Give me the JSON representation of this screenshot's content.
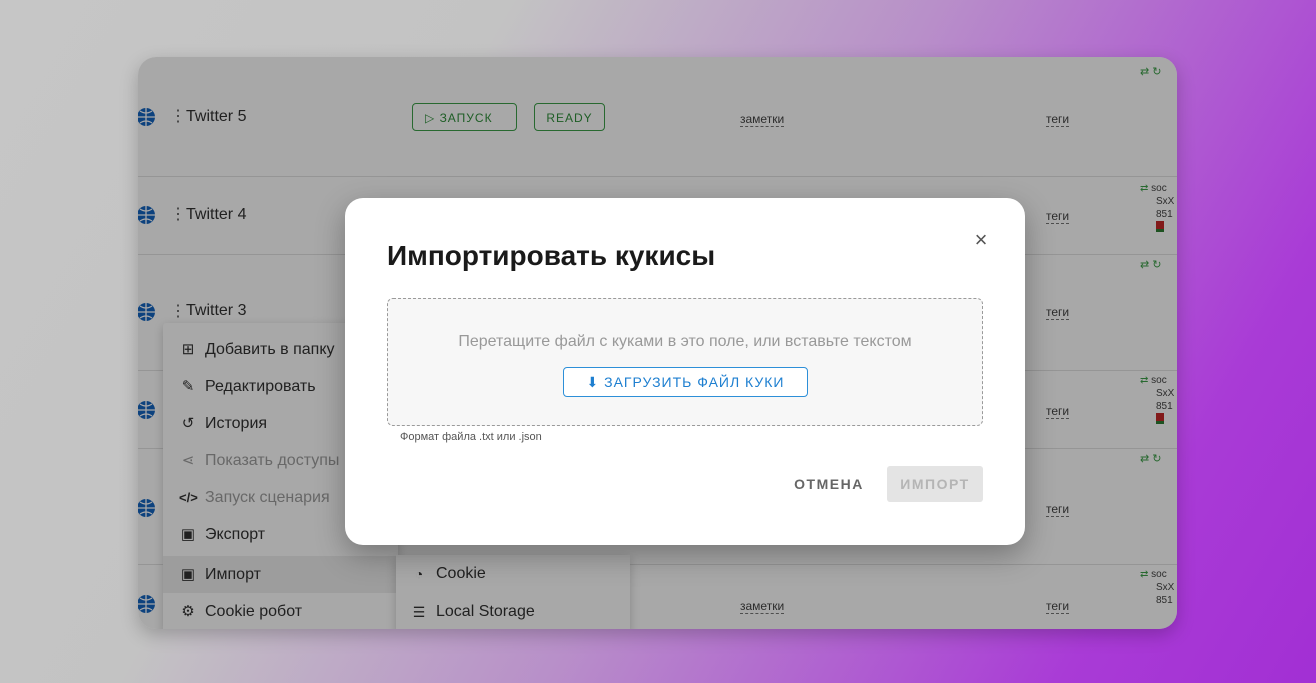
{
  "profiles": [
    {
      "name": "Twitter 5",
      "launch": "ЗАПУСК",
      "status": "READY",
      "notes": "заметки",
      "tags": "теги",
      "info": []
    },
    {
      "name": "Twitter 4",
      "tags": "теги",
      "info": [
        "soc",
        "SxX",
        "851"
      ]
    },
    {
      "name": "Twitter 3",
      "tags": "теги",
      "info": []
    },
    {
      "name": "",
      "tags": "теги",
      "info": [
        "soc",
        "SxX",
        "851"
      ]
    },
    {
      "name": "",
      "tags": "теги",
      "info": []
    },
    {
      "name": "",
      "notes": "заметки",
      "tags": "теги",
      "info": [
        "soc",
        "SxX",
        "851"
      ]
    }
  ],
  "context_menu": [
    {
      "label": "Добавить в папку",
      "icon": "folder-plus-icon",
      "glyph": "⊞",
      "disabled": false
    },
    {
      "label": "Редактировать",
      "icon": "edit-icon",
      "glyph": "✎",
      "disabled": false
    },
    {
      "label": "История",
      "icon": "history-icon",
      "glyph": "↺",
      "disabled": false
    },
    {
      "label": "Показать доступы",
      "icon": "share-icon",
      "glyph": "⋖",
      "disabled": true
    },
    {
      "label": "Запуск сценария",
      "icon": "code-icon",
      "glyph": "</>",
      "disabled": true
    },
    {
      "label": "Экспорт",
      "icon": "export-icon",
      "glyph": "▣",
      "disabled": false
    },
    {
      "label": "Импорт",
      "icon": "import-icon",
      "glyph": "▣",
      "disabled": false
    },
    {
      "label": "Cookie робот",
      "icon": "cookie-robot-icon",
      "glyph": "⚙",
      "disabled": false
    }
  ],
  "submenu": [
    {
      "label": "Cookie",
      "icon": "cookie-icon",
      "glyph": "◔"
    },
    {
      "label": "Local Storage",
      "icon": "storage-icon",
      "glyph": "☰"
    }
  ],
  "modal": {
    "title": "Импортировать кукисы",
    "dropzone_text": "Перетащите файл с куками в это поле, или вставьте текстом",
    "upload_label": "ЗАГРУЗИТЬ ФАЙЛ КУКИ",
    "hint": "Формат файла .txt или .json",
    "cancel_label": "ОТМЕНА",
    "import_label": "ИМПОРТ"
  },
  "colors": {
    "accent": "#1e7fd0",
    "success": "#2f8f3b",
    "globe": "#1565c0"
  }
}
